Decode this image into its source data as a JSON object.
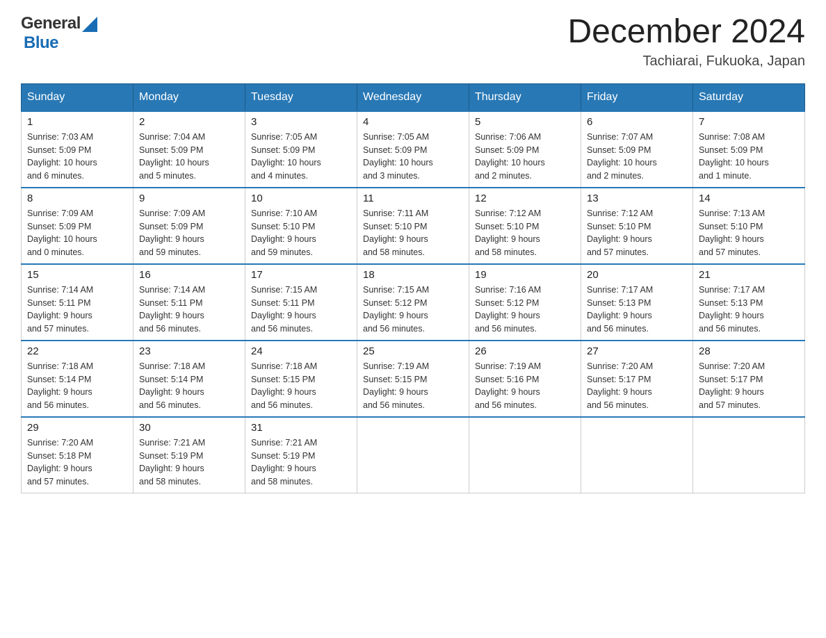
{
  "header": {
    "logo_general": "General",
    "logo_blue": "Blue",
    "month_year": "December 2024",
    "location": "Tachiarai, Fukuoka, Japan"
  },
  "weekdays": [
    "Sunday",
    "Monday",
    "Tuesday",
    "Wednesday",
    "Thursday",
    "Friday",
    "Saturday"
  ],
  "weeks": [
    [
      {
        "day": "1",
        "sunrise": "7:03 AM",
        "sunset": "5:09 PM",
        "daylight": "10 hours and 6 minutes."
      },
      {
        "day": "2",
        "sunrise": "7:04 AM",
        "sunset": "5:09 PM",
        "daylight": "10 hours and 5 minutes."
      },
      {
        "day": "3",
        "sunrise": "7:05 AM",
        "sunset": "5:09 PM",
        "daylight": "10 hours and 4 minutes."
      },
      {
        "day": "4",
        "sunrise": "7:05 AM",
        "sunset": "5:09 PM",
        "daylight": "10 hours and 3 minutes."
      },
      {
        "day": "5",
        "sunrise": "7:06 AM",
        "sunset": "5:09 PM",
        "daylight": "10 hours and 2 minutes."
      },
      {
        "day": "6",
        "sunrise": "7:07 AM",
        "sunset": "5:09 PM",
        "daylight": "10 hours and 2 minutes."
      },
      {
        "day": "7",
        "sunrise": "7:08 AM",
        "sunset": "5:09 PM",
        "daylight": "10 hours and 1 minute."
      }
    ],
    [
      {
        "day": "8",
        "sunrise": "7:09 AM",
        "sunset": "5:09 PM",
        "daylight": "10 hours and 0 minutes."
      },
      {
        "day": "9",
        "sunrise": "7:09 AM",
        "sunset": "5:09 PM",
        "daylight": "9 hours and 59 minutes."
      },
      {
        "day": "10",
        "sunrise": "7:10 AM",
        "sunset": "5:10 PM",
        "daylight": "9 hours and 59 minutes."
      },
      {
        "day": "11",
        "sunrise": "7:11 AM",
        "sunset": "5:10 PM",
        "daylight": "9 hours and 58 minutes."
      },
      {
        "day": "12",
        "sunrise": "7:12 AM",
        "sunset": "5:10 PM",
        "daylight": "9 hours and 58 minutes."
      },
      {
        "day": "13",
        "sunrise": "7:12 AM",
        "sunset": "5:10 PM",
        "daylight": "9 hours and 57 minutes."
      },
      {
        "day": "14",
        "sunrise": "7:13 AM",
        "sunset": "5:10 PM",
        "daylight": "9 hours and 57 minutes."
      }
    ],
    [
      {
        "day": "15",
        "sunrise": "7:14 AM",
        "sunset": "5:11 PM",
        "daylight": "9 hours and 57 minutes."
      },
      {
        "day": "16",
        "sunrise": "7:14 AM",
        "sunset": "5:11 PM",
        "daylight": "9 hours and 56 minutes."
      },
      {
        "day": "17",
        "sunrise": "7:15 AM",
        "sunset": "5:11 PM",
        "daylight": "9 hours and 56 minutes."
      },
      {
        "day": "18",
        "sunrise": "7:15 AM",
        "sunset": "5:12 PM",
        "daylight": "9 hours and 56 minutes."
      },
      {
        "day": "19",
        "sunrise": "7:16 AM",
        "sunset": "5:12 PM",
        "daylight": "9 hours and 56 minutes."
      },
      {
        "day": "20",
        "sunrise": "7:17 AM",
        "sunset": "5:13 PM",
        "daylight": "9 hours and 56 minutes."
      },
      {
        "day": "21",
        "sunrise": "7:17 AM",
        "sunset": "5:13 PM",
        "daylight": "9 hours and 56 minutes."
      }
    ],
    [
      {
        "day": "22",
        "sunrise": "7:18 AM",
        "sunset": "5:14 PM",
        "daylight": "9 hours and 56 minutes."
      },
      {
        "day": "23",
        "sunrise": "7:18 AM",
        "sunset": "5:14 PM",
        "daylight": "9 hours and 56 minutes."
      },
      {
        "day": "24",
        "sunrise": "7:18 AM",
        "sunset": "5:15 PM",
        "daylight": "9 hours and 56 minutes."
      },
      {
        "day": "25",
        "sunrise": "7:19 AM",
        "sunset": "5:15 PM",
        "daylight": "9 hours and 56 minutes."
      },
      {
        "day": "26",
        "sunrise": "7:19 AM",
        "sunset": "5:16 PM",
        "daylight": "9 hours and 56 minutes."
      },
      {
        "day": "27",
        "sunrise": "7:20 AM",
        "sunset": "5:17 PM",
        "daylight": "9 hours and 56 minutes."
      },
      {
        "day": "28",
        "sunrise": "7:20 AM",
        "sunset": "5:17 PM",
        "daylight": "9 hours and 57 minutes."
      }
    ],
    [
      {
        "day": "29",
        "sunrise": "7:20 AM",
        "sunset": "5:18 PM",
        "daylight": "9 hours and 57 minutes."
      },
      {
        "day": "30",
        "sunrise": "7:21 AM",
        "sunset": "5:19 PM",
        "daylight": "9 hours and 58 minutes."
      },
      {
        "day": "31",
        "sunrise": "7:21 AM",
        "sunset": "5:19 PM",
        "daylight": "9 hours and 58 minutes."
      },
      null,
      null,
      null,
      null
    ]
  ],
  "labels": {
    "sunrise": "Sunrise:",
    "sunset": "Sunset:",
    "daylight": "Daylight:"
  }
}
